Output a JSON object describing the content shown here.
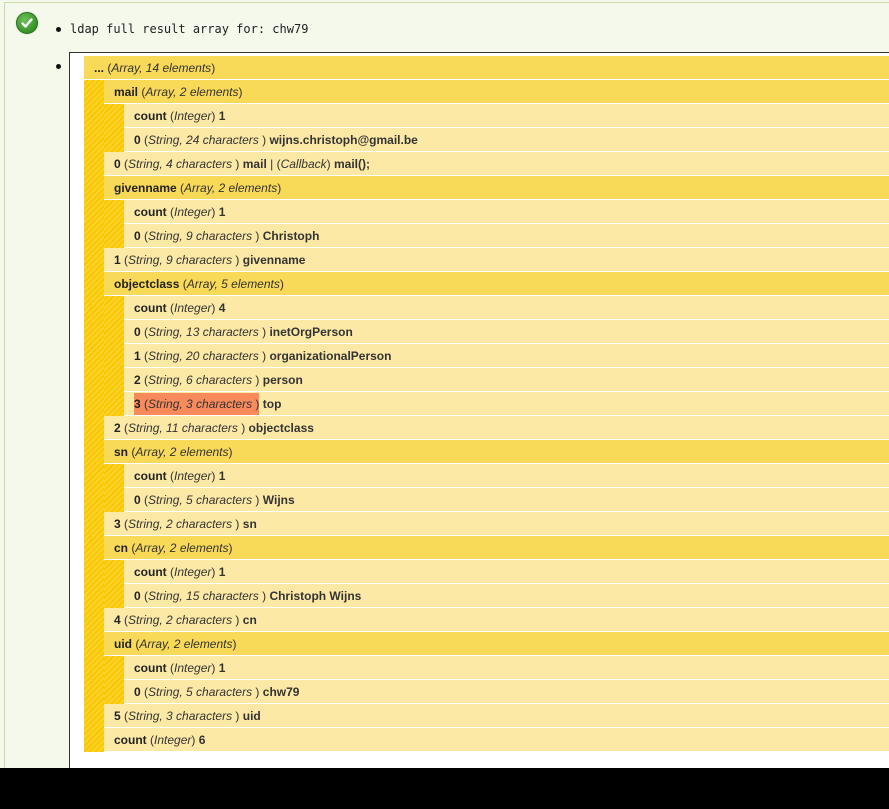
{
  "message": {
    "text": "ldap full result array for: chw79"
  },
  "root": {
    "key": "...",
    "meta": "Array, 14 elements"
  },
  "rows": [
    {
      "lvl": 1,
      "type": "arr",
      "key": "mail",
      "meta": "Array, 2 elements"
    },
    {
      "lvl": 2,
      "type": "val",
      "key": "count",
      "meta": "Integer",
      "value": "1"
    },
    {
      "lvl": 2,
      "type": "val",
      "key": "0",
      "meta": "String, 24 characters ",
      "value": "wijns.christoph@gmail.be"
    },
    {
      "lvl": 1,
      "type": "val",
      "key": "0",
      "meta": "String, 4 characters ",
      "value": "mail",
      "extra_sep": "|",
      "extra_meta": "Callback",
      "extra_value": "mail();"
    },
    {
      "lvl": 1,
      "type": "arr",
      "key": "givenname",
      "meta": "Array, 2 elements"
    },
    {
      "lvl": 2,
      "type": "val",
      "key": "count",
      "meta": "Integer",
      "value": "1"
    },
    {
      "lvl": 2,
      "type": "val",
      "key": "0",
      "meta": "String, 9 characters ",
      "value": "Christoph"
    },
    {
      "lvl": 1,
      "type": "val",
      "key": "1",
      "meta": "String, 9 characters ",
      "value": "givenname"
    },
    {
      "lvl": 1,
      "type": "arr",
      "key": "objectclass",
      "meta": "Array, 5 elements"
    },
    {
      "lvl": 2,
      "type": "val",
      "key": "count",
      "meta": "Integer",
      "value": "4"
    },
    {
      "lvl": 2,
      "type": "val",
      "key": "0",
      "meta": "String, 13 characters ",
      "value": "inetOrgPerson"
    },
    {
      "lvl": 2,
      "type": "val",
      "key": "1",
      "meta": "String, 20 characters ",
      "value": "organizationalPerson"
    },
    {
      "lvl": 2,
      "type": "val",
      "key": "2",
      "meta": "String, 6 characters ",
      "value": "person"
    },
    {
      "lvl": 2,
      "type": "val",
      "key": "3",
      "meta": "String, 3 characters ",
      "value": "top",
      "highlight": true
    },
    {
      "lvl": 1,
      "type": "val",
      "key": "2",
      "meta": "String, 11 characters ",
      "value": "objectclass"
    },
    {
      "lvl": 1,
      "type": "arr",
      "key": "sn",
      "meta": "Array, 2 elements"
    },
    {
      "lvl": 2,
      "type": "val",
      "key": "count",
      "meta": "Integer",
      "value": "1"
    },
    {
      "lvl": 2,
      "type": "val",
      "key": "0",
      "meta": "String, 5 characters ",
      "value": "Wijns"
    },
    {
      "lvl": 1,
      "type": "val",
      "key": "3",
      "meta": "String, 2 characters ",
      "value": "sn"
    },
    {
      "lvl": 1,
      "type": "arr",
      "key": "cn",
      "meta": "Array, 2 elements"
    },
    {
      "lvl": 2,
      "type": "val",
      "key": "count",
      "meta": "Integer",
      "value": "1"
    },
    {
      "lvl": 2,
      "type": "val",
      "key": "0",
      "meta": "String, 15 characters ",
      "value": "Christoph Wijns"
    },
    {
      "lvl": 1,
      "type": "val",
      "key": "4",
      "meta": "String, 2 characters ",
      "value": "cn"
    },
    {
      "lvl": 1,
      "type": "arr",
      "key": "uid",
      "meta": "Array, 2 elements"
    },
    {
      "lvl": 2,
      "type": "val",
      "key": "count",
      "meta": "Integer",
      "value": "1"
    },
    {
      "lvl": 2,
      "type": "val",
      "key": "0",
      "meta": "String, 5 characters ",
      "value": "chw79"
    },
    {
      "lvl": 1,
      "type": "val",
      "key": "5",
      "meta": "String, 3 characters ",
      "value": "uid"
    },
    {
      "lvl": 1,
      "type": "val",
      "key": "count",
      "meta": "Integer",
      "value": "6"
    }
  ],
  "colors": {
    "array_row": "#f8d958",
    "value_row": "#fde9a6",
    "indent_bar": "#f9c800",
    "highlight": "#f98a5c",
    "success": "#3c9a2e"
  },
  "icons": {
    "status": "check-circle-icon"
  }
}
